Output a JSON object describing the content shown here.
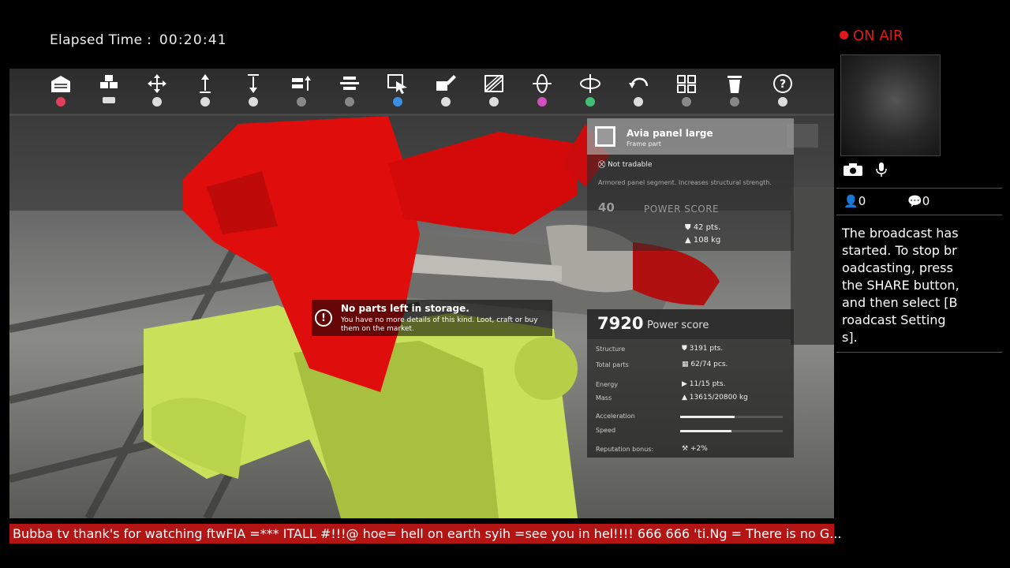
{
  "elapsed": {
    "label": "Elapsed Time :",
    "value": "00:20:41"
  },
  "toolbar": {
    "tools": [
      {
        "icon": "garage-icon",
        "button": "circle"
      },
      {
        "icon": "parts-stack-icon",
        "button": "touchpad"
      },
      {
        "icon": "move-icon",
        "button": "l-stick"
      },
      {
        "icon": "raise-icon",
        "button": "r1"
      },
      {
        "icon": "lower-icon",
        "button": "r2"
      },
      {
        "icon": "align-up-icon",
        "button": "dpad"
      },
      {
        "icon": "align-center-icon",
        "button": "dpad"
      },
      {
        "icon": "select-part-icon",
        "button": "cross"
      },
      {
        "icon": "paint-icon",
        "button": "l1"
      },
      {
        "icon": "blueprint-icon",
        "button": "r1"
      },
      {
        "icon": "rotate-vertical-icon",
        "button": "square"
      },
      {
        "icon": "rotate-horizontal-icon",
        "button": "triangle"
      },
      {
        "icon": "undo-icon",
        "button": "l2"
      },
      {
        "icon": "grid-icon",
        "button": "dpad"
      },
      {
        "icon": "trash-icon",
        "button": "dpad"
      },
      {
        "icon": "help-icon",
        "button": "r3"
      }
    ]
  },
  "item_card": {
    "title": "Avia panel large",
    "subtitle": "Frame part",
    "trade_status": "Not tradable",
    "description": "Armored panel segment. Increases structural strength.",
    "score": "40",
    "score_label": "POWER SCORE",
    "stat1": "42 pts.",
    "stat2": "108 kg"
  },
  "notice": {
    "title": "No parts left in storage.",
    "body": "You have no more details of this kind. Loot, craft or buy them on the market."
  },
  "power_panel": {
    "score": "7920",
    "score_label": "Power score",
    "rows": [
      {
        "label": "Structure",
        "value": "3191 pts."
      },
      {
        "label": "Total parts",
        "value": "62/74 pcs."
      },
      {
        "label": "Energy",
        "value": "11/15 pts."
      },
      {
        "label": "Mass",
        "value": "13615/20800 kg"
      }
    ],
    "acceleration_label": "Acceleration",
    "acceleration_level": 0.53,
    "speed_label": "Speed",
    "speed_level": 0.5,
    "reputation_label": "Reputation bonus:",
    "reputation_value": "+2%"
  },
  "ticker": {
    "text": "Bubba tv thank's for watching ftwFIA  =*** ITALL #!!!@ hoe= hell on earth syih =see you in hel!!!! 666 666 'ti.Ng = There is no G..."
  },
  "sidebar": {
    "on_air": "ON AIR",
    "viewers": "0",
    "comments": "0",
    "message": "The broadcast has started. To stop broadcasting, press the SHARE button, and then select [Broadcast Settings]."
  },
  "colors": {
    "ticker": "#b31414",
    "on_air": "#e01a1a",
    "highlight_part": "#e00d0d",
    "frame": "#c9e05a"
  }
}
